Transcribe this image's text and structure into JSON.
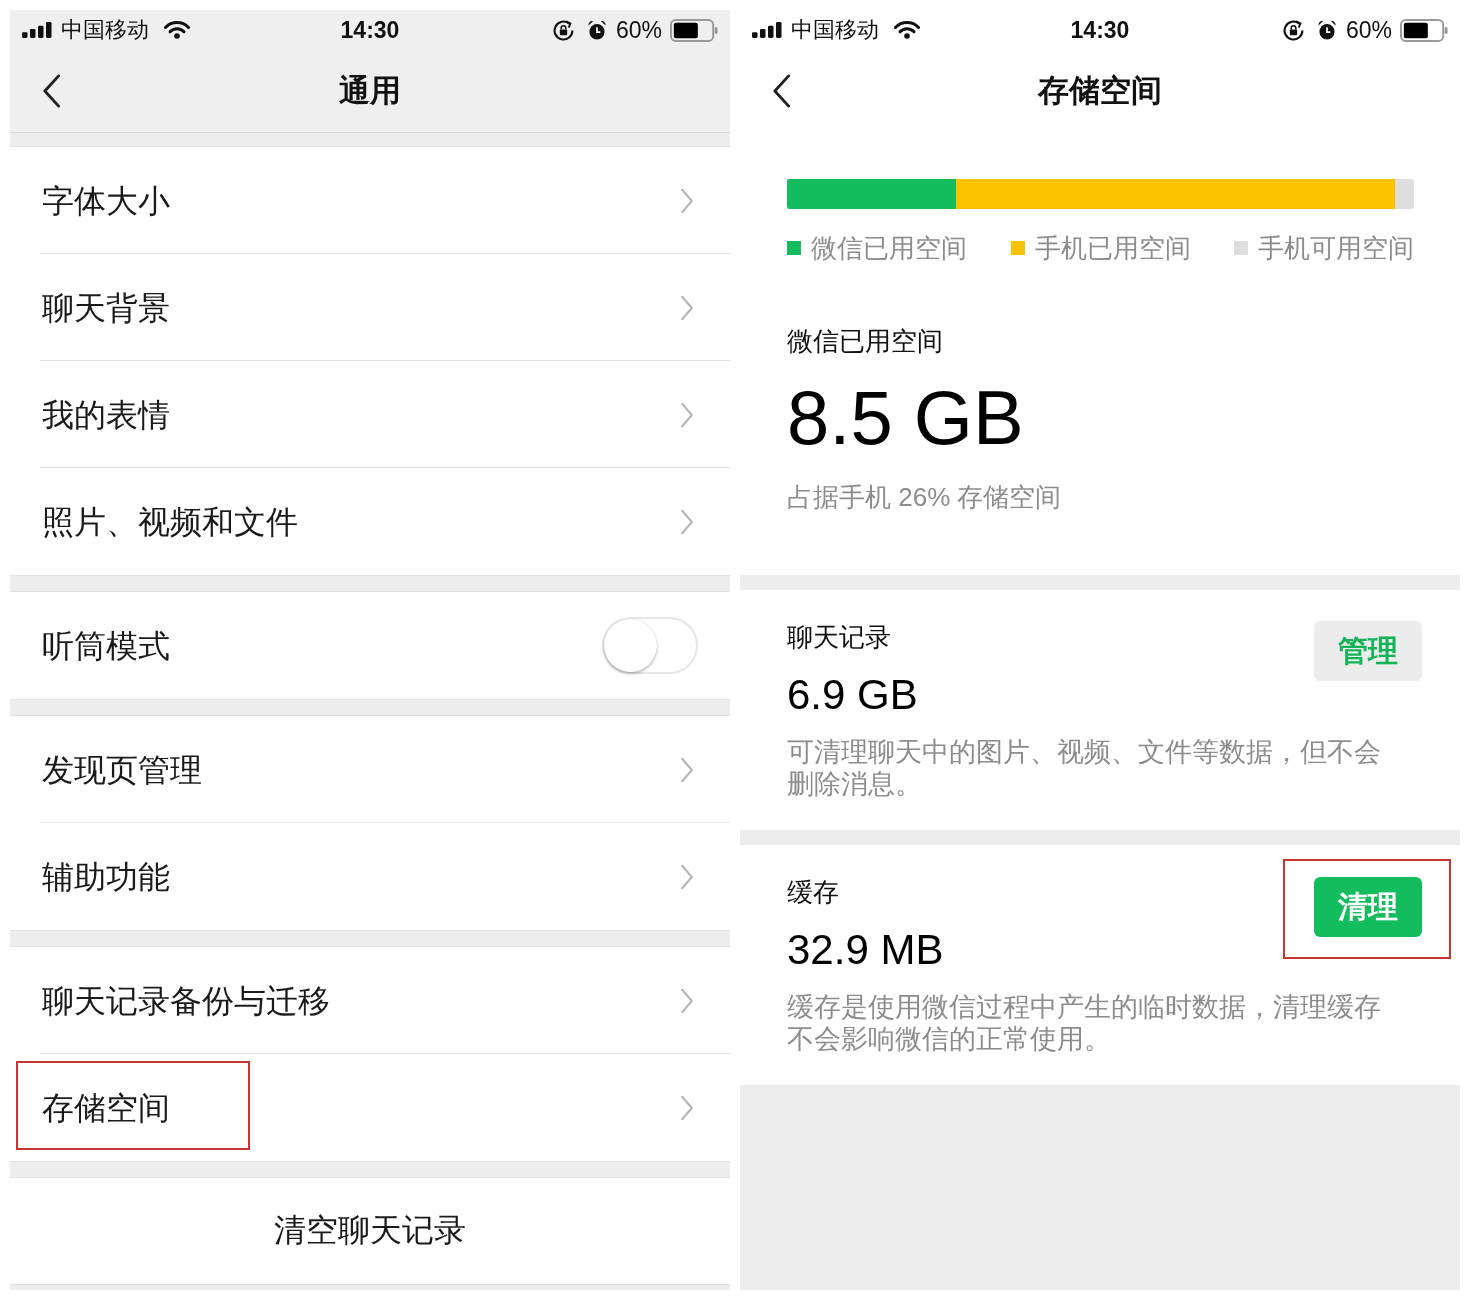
{
  "general_screen": {
    "status_bar": {
      "carrier": "中国移动",
      "time": "14:30",
      "battery_percent": "60%"
    },
    "nav_bar": {
      "title": "通用"
    },
    "groups": [
      {
        "items": [
          {
            "kind": "link",
            "label": "字体大小",
            "highlighted": false
          },
          {
            "kind": "link",
            "label": "聊天背景",
            "highlighted": false
          },
          {
            "kind": "link",
            "label": "我的表情",
            "highlighted": false
          },
          {
            "kind": "link",
            "label": "照片、视频和文件",
            "highlighted": false
          }
        ]
      },
      {
        "items": [
          {
            "kind": "toggle",
            "label": "听筒模式",
            "on": false,
            "highlighted": false
          }
        ]
      },
      {
        "items": [
          {
            "kind": "link",
            "label": "发现页管理",
            "highlighted": false
          },
          {
            "kind": "link",
            "label": "辅助功能",
            "highlighted": false
          }
        ]
      },
      {
        "items": [
          {
            "kind": "link",
            "label": "聊天记录备份与迁移",
            "highlighted": false
          },
          {
            "kind": "link",
            "label": "存储空间",
            "highlighted": true
          }
        ]
      },
      {
        "items": [
          {
            "kind": "action",
            "label": "清空聊天记录",
            "highlighted": false
          }
        ]
      }
    ]
  },
  "storage_screen": {
    "status_bar": {
      "carrier": "中国移动",
      "time": "14:30",
      "battery_percent": "60%"
    },
    "nav_bar": {
      "title": "存储空间"
    },
    "usage_bar": {
      "segments": [
        {
          "label": "微信已用空间",
          "color": "#13bd5d",
          "level": 0.27
        },
        {
          "label": "手机已用空间",
          "color": "#fac300",
          "level": 0.97
        },
        {
          "label": "手机可用空间",
          "color": "#dedede"
        }
      ]
    },
    "summary": {
      "label": "微信已用空间",
      "value": "8.5 GB",
      "note": "占据手机 26% 存储空间"
    },
    "sections": [
      {
        "title": "聊天记录",
        "size": "6.9 GB",
        "description": "可清理聊天中的图片、视频、文件等数据，但不会删除消息。",
        "button": {
          "kind": "secondary",
          "label": "管理",
          "highlighted": false
        }
      },
      {
        "title": "缓存",
        "size": "32.9 MB",
        "description": "缓存是使用微信过程中产生的临时数据，清理缓存不会影响微信的正常使用。",
        "button": {
          "kind": "primary",
          "label": "清理",
          "highlighted": true
        }
      }
    ]
  }
}
